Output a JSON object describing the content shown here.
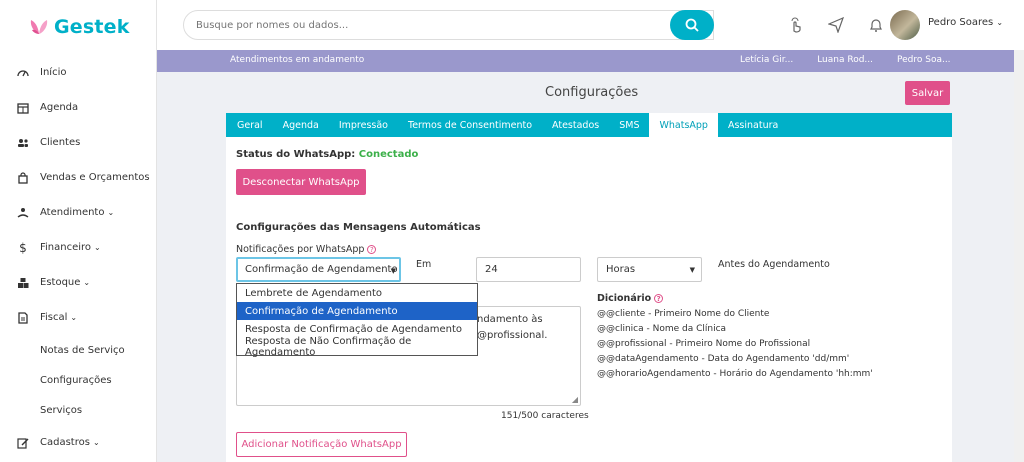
{
  "app": {
    "name": "Gestek"
  },
  "search": {
    "placeholder": "Busque por nomes ou dados..."
  },
  "user": {
    "name": "Pedro Soares"
  },
  "sidebar": {
    "items": [
      {
        "label": "Início",
        "icon": "dashboard-icon"
      },
      {
        "label": "Agenda",
        "icon": "calendar-icon"
      },
      {
        "label": "Clientes",
        "icon": "users-icon"
      },
      {
        "label": "Vendas e Orçamentos",
        "icon": "shopping-bag-icon"
      },
      {
        "label": "Atendimento",
        "icon": "service-icon"
      },
      {
        "label": "Financeiro",
        "icon": "dollar-icon"
      },
      {
        "label": "Estoque",
        "icon": "boxes-icon"
      },
      {
        "label": "Fiscal",
        "icon": "file-icon"
      }
    ],
    "sub_items": [
      "Notas de Serviço",
      "Configurações",
      "Serviços"
    ],
    "cadastros": "Cadastros"
  },
  "statusbar": {
    "label": "Atendimentos em andamento",
    "names": [
      "Letícia Gir...",
      "Luana Rod...",
      "Pedro Soa..."
    ]
  },
  "page": {
    "title": "Configurações",
    "save_label": "Salvar"
  },
  "tabs": [
    "Geral",
    "Agenda",
    "Impressão",
    "Termos de Consentimento",
    "Atestados",
    "SMS",
    "WhatsApp",
    "Assinatura"
  ],
  "whatsapp": {
    "status_label": "Status do WhatsApp:",
    "status_value": "Conectado",
    "disconnect_label": "Desconectar WhatsApp",
    "section_title": "Configurações das Mensagens Automáticas",
    "notif_label": "Notificações por WhatsApp",
    "selected_type": "Confirmação de Agendamento",
    "options": [
      "Lembrete de Agendamento",
      "Confirmação de Agendamento",
      "Resposta de Confirmação de Agendamento",
      "Resposta de Não Confirmação de Agendamento"
    ],
    "em_label": "Em",
    "amount": "24",
    "unit": "Horas",
    "antes_label": "Antes do Agendamento",
    "message_line1": "ndamento às",
    "message_line2": "@profissional.",
    "counter": "151/500 caracteres",
    "dict_title": "Dicionário",
    "dictionary": [
      "@@cliente - Primeiro Nome do Cliente",
      "@@clinica - Nome da Clínica",
      "@@profissional - Primeiro Nome do Profissional",
      "@@dataAgendamento - Data do Agendamento 'dd/mm'",
      "@@horarioAgendamento - Horário do Agendamento 'hh:mm'"
    ],
    "add_label": "Adicionar Notificação WhatsApp"
  },
  "colors": {
    "brand": "#00b0c8",
    "accent": "#e0508a",
    "statusbar": "#9a98cc",
    "success": "#3cb04a"
  }
}
